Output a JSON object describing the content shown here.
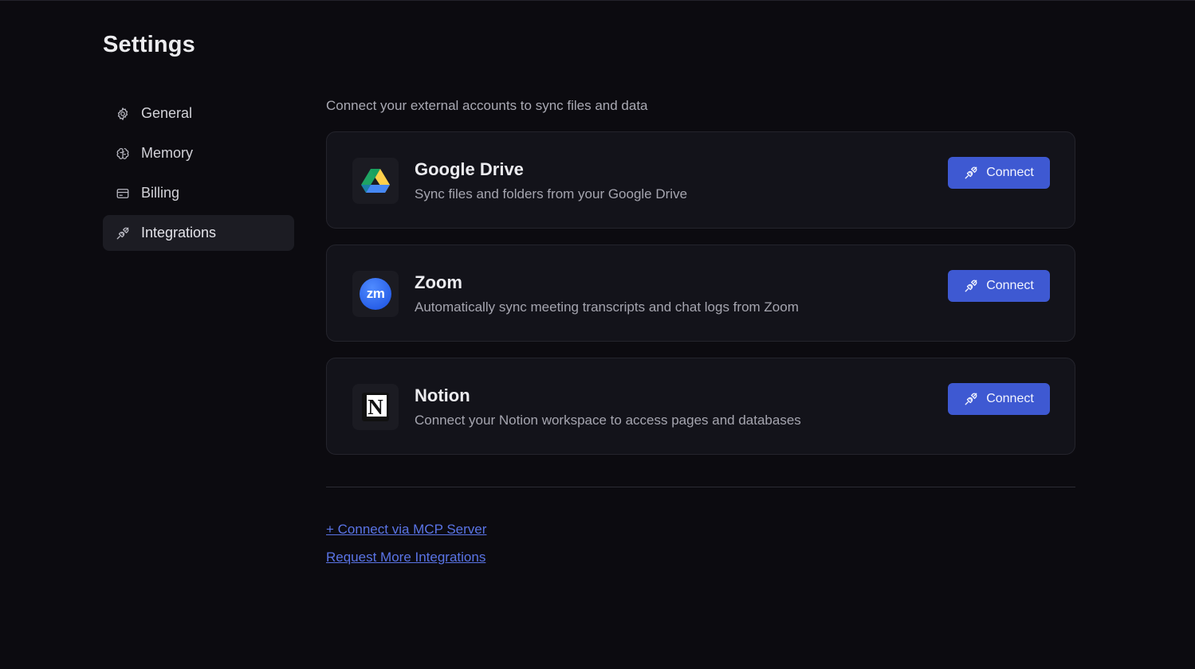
{
  "page": {
    "title": "Settings"
  },
  "sidebar": {
    "items": [
      {
        "label": "General",
        "icon": "gear-icon",
        "active": false
      },
      {
        "label": "Memory",
        "icon": "brain-icon",
        "active": false
      },
      {
        "label": "Billing",
        "icon": "credit-card-icon",
        "active": false
      },
      {
        "label": "Integrations",
        "icon": "plug-icon",
        "active": true
      }
    ]
  },
  "main": {
    "intro": "Connect your external accounts to sync files and data",
    "integrations": [
      {
        "name": "Google Drive",
        "description": "Sync files and folders from your Google Drive",
        "icon": "google-drive-logo",
        "button_label": "Connect"
      },
      {
        "name": "Zoom",
        "description": "Automatically sync meeting transcripts and chat logs from Zoom",
        "icon": "zoom-logo",
        "logo_text": "zm",
        "button_label": "Connect"
      },
      {
        "name": "Notion",
        "description": "Connect your Notion workspace to access pages and databases",
        "icon": "notion-logo",
        "logo_text": "N",
        "button_label": "Connect"
      }
    ],
    "links": {
      "mcp": "+ Connect via MCP Server",
      "request": "Request More Integrations"
    }
  },
  "colors": {
    "background": "#0c0b10",
    "card": "#13131a",
    "accent": "#3e59d2",
    "link": "#5a74e6"
  }
}
